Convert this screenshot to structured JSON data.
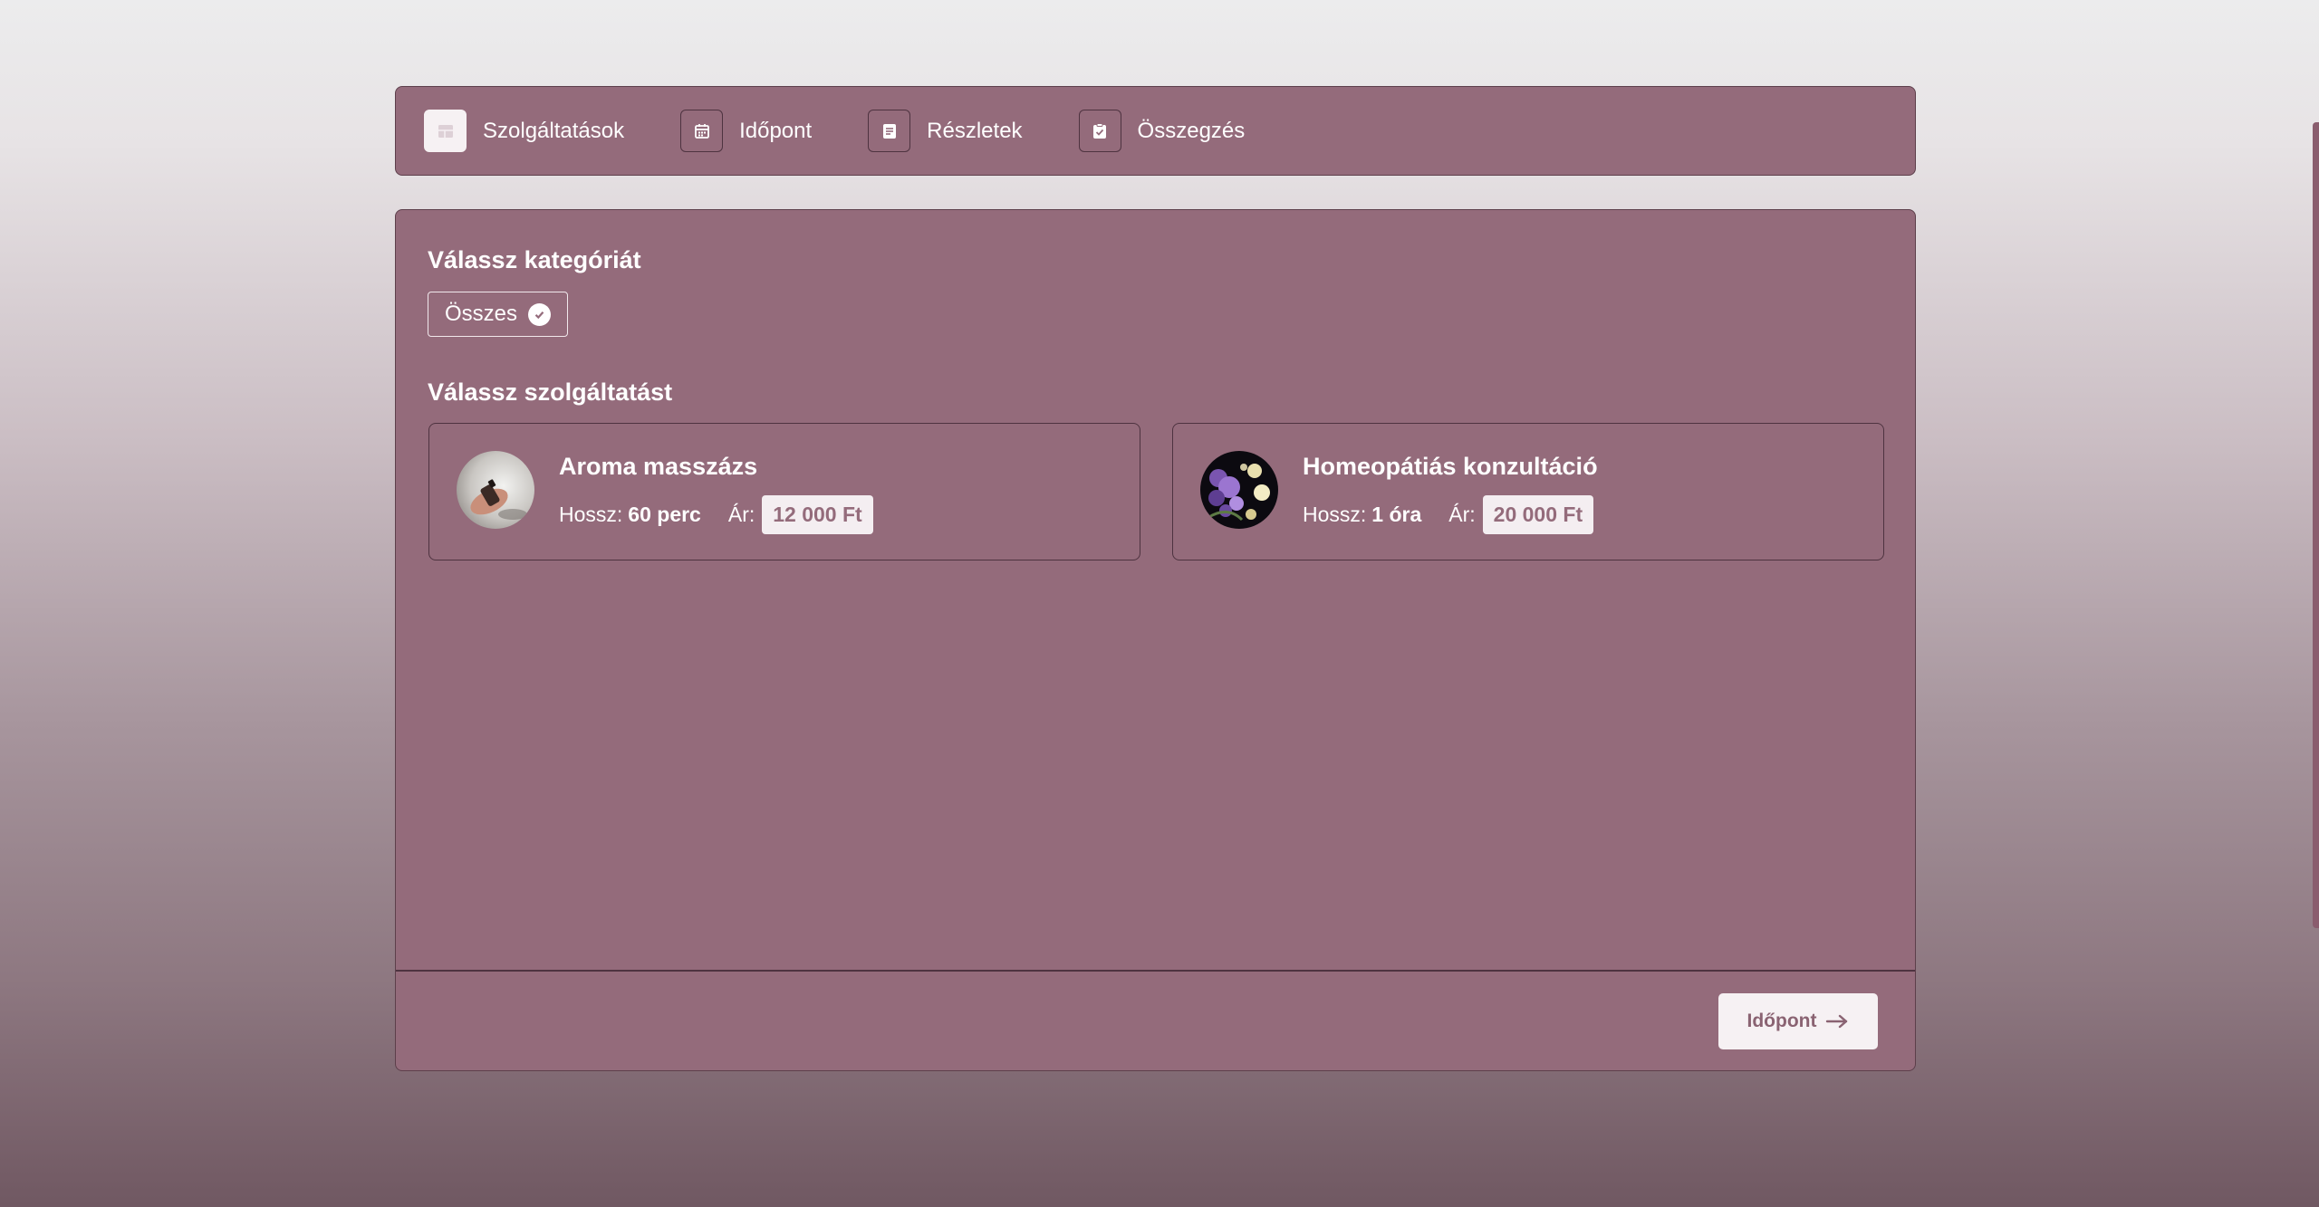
{
  "stepper": {
    "steps": [
      {
        "label": "Szolgáltatások",
        "icon": "services-icon",
        "active": true
      },
      {
        "label": "Időpont",
        "icon": "calendar-icon",
        "active": false
      },
      {
        "label": "Részletek",
        "icon": "details-icon",
        "active": false
      },
      {
        "label": "Összegzés",
        "icon": "clipboard-check-icon",
        "active": false
      }
    ]
  },
  "category": {
    "title": "Válassz kategóriát",
    "chip_label": "Összes"
  },
  "services": {
    "title": "Válassz szolgáltatást",
    "items": [
      {
        "name": "Aroma masszázs",
        "duration_label": "Hossz:",
        "duration": "60 perc",
        "price_label": "Ár:",
        "price": "12 000 Ft"
      },
      {
        "name": "Homeopátiás konzultáció",
        "duration_label": "Hossz:",
        "duration": "1 óra",
        "price_label": "Ár:",
        "price": "20 000 Ft"
      }
    ]
  },
  "footer": {
    "next_label": "Időpont"
  },
  "colors": {
    "panel": "#946b7b",
    "border": "#5d3f4b",
    "accent_light": "#f6f1f3"
  }
}
